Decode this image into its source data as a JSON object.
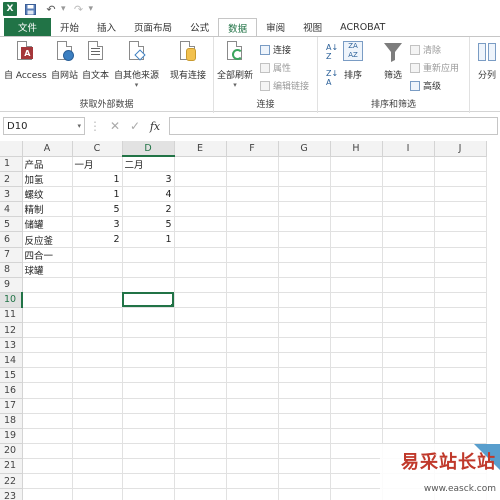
{
  "titlebar": {
    "app_icon": "X"
  },
  "tabs": [
    "文件",
    "开始",
    "插入",
    "页面布局",
    "公式",
    "数据",
    "审阅",
    "视图",
    "ACROBAT"
  ],
  "ribbon": {
    "get_external": {
      "label": "获取外部数据",
      "buttons": [
        "自 Access",
        "自网站",
        "自文本",
        "自其他来源",
        "现有连接"
      ]
    },
    "connections": {
      "label": "连接",
      "refresh_all": "全部刷新",
      "links": [
        "连接",
        "属性",
        "编辑链接"
      ]
    },
    "sort_filter": {
      "label": "排序和筛选",
      "sort": "排序",
      "filter": "筛选",
      "links": [
        "清除",
        "重新应用",
        "高级"
      ]
    },
    "data_tools": {
      "split": "分列"
    }
  },
  "formula_bar": {
    "name_box": "D10",
    "fx": "fx",
    "formula": ""
  },
  "sheet": {
    "columns": [
      "A",
      "C",
      "D",
      "E",
      "F",
      "G",
      "H",
      "I",
      "J"
    ],
    "selected_col": "D",
    "selected_row": "10",
    "rows": [
      {
        "n": "1",
        "cells": [
          "产品",
          "一月",
          "二月",
          "",
          "",
          "",
          "",
          "",
          ""
        ]
      },
      {
        "n": "2",
        "cells": [
          "加氢",
          "1",
          "3",
          "",
          "",
          "",
          "",
          "",
          ""
        ]
      },
      {
        "n": "3",
        "cells": [
          "螺纹",
          "1",
          "4",
          "",
          "",
          "",
          "",
          "",
          ""
        ]
      },
      {
        "n": "4",
        "cells": [
          "精制",
          "5",
          "2",
          "",
          "",
          "",
          "",
          "",
          ""
        ]
      },
      {
        "n": "5",
        "cells": [
          "储罐",
          "3",
          "5",
          "",
          "",
          "",
          "",
          "",
          ""
        ]
      },
      {
        "n": "6",
        "cells": [
          "反应釜",
          "2",
          "1",
          "",
          "",
          "",
          "",
          "",
          ""
        ]
      },
      {
        "n": "7",
        "cells": [
          "四合一",
          "",
          "",
          "",
          "",
          "",
          "",
          "",
          ""
        ]
      },
      {
        "n": "8",
        "cells": [
          "球罐",
          "",
          "",
          "",
          "",
          "",
          "",
          "",
          ""
        ]
      },
      {
        "n": "9",
        "cells": [
          "",
          "",
          "",
          "",
          "",
          "",
          "",
          "",
          ""
        ]
      },
      {
        "n": "10",
        "cells": [
          "",
          "",
          "",
          "",
          "",
          "",
          "",
          "",
          ""
        ]
      },
      {
        "n": "11",
        "cells": [
          "",
          "",
          "",
          "",
          "",
          "",
          "",
          "",
          ""
        ]
      },
      {
        "n": "12",
        "cells": [
          "",
          "",
          "",
          "",
          "",
          "",
          "",
          "",
          ""
        ]
      },
      {
        "n": "13",
        "cells": [
          "",
          "",
          "",
          "",
          "",
          "",
          "",
          "",
          ""
        ]
      },
      {
        "n": "14",
        "cells": [
          "",
          "",
          "",
          "",
          "",
          "",
          "",
          "",
          ""
        ]
      },
      {
        "n": "15",
        "cells": [
          "",
          "",
          "",
          "",
          "",
          "",
          "",
          "",
          ""
        ]
      },
      {
        "n": "16",
        "cells": [
          "",
          "",
          "",
          "",
          "",
          "",
          "",
          "",
          ""
        ]
      },
      {
        "n": "17",
        "cells": [
          "",
          "",
          "",
          "",
          "",
          "",
          "",
          "",
          ""
        ]
      },
      {
        "n": "18",
        "cells": [
          "",
          "",
          "",
          "",
          "",
          "",
          "",
          "",
          ""
        ]
      },
      {
        "n": "19",
        "cells": [
          "",
          "",
          "",
          "",
          "",
          "",
          "",
          "",
          ""
        ]
      },
      {
        "n": "20",
        "cells": [
          "",
          "",
          "",
          "",
          "",
          "",
          "",
          "",
          ""
        ]
      },
      {
        "n": "21",
        "cells": [
          "",
          "",
          "",
          "",
          "",
          "",
          "",
          "",
          ""
        ]
      },
      {
        "n": "22",
        "cells": [
          "",
          "",
          "",
          "",
          "",
          "",
          "",
          "",
          ""
        ]
      },
      {
        "n": "23",
        "cells": [
          "",
          "",
          "",
          "",
          "",
          "",
          "",
          "",
          ""
        ]
      }
    ]
  },
  "watermark": {
    "text": "易采站长站",
    "url": "www.easck.com"
  }
}
